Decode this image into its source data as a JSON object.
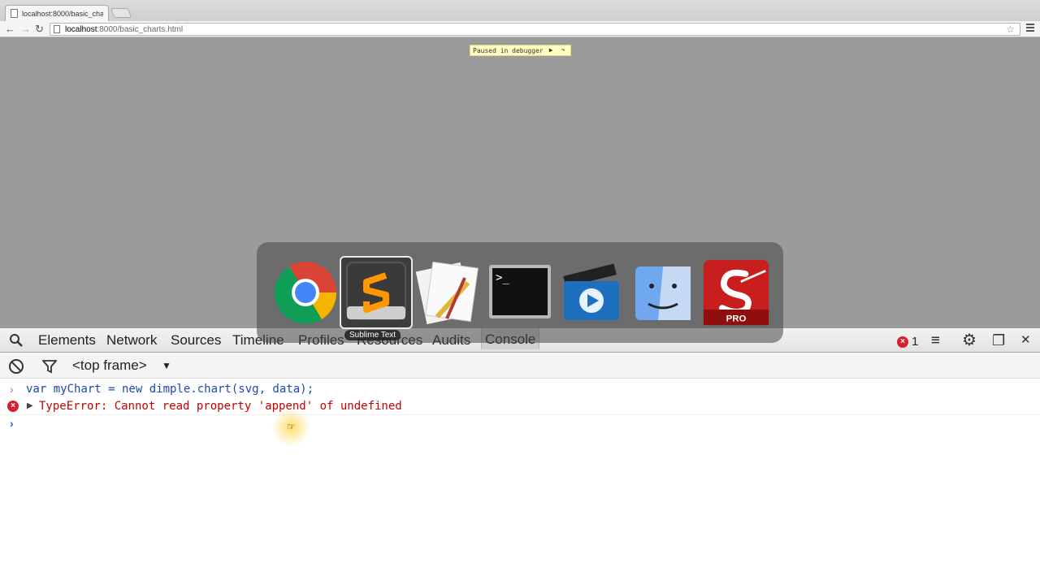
{
  "browser": {
    "tab_title": "localhost:8000/basic_char",
    "url_host": "localhost",
    "url_rest": ":8000/basic_charts.html"
  },
  "page": {
    "paused_text": "Paused in debugger"
  },
  "devtools": {
    "tabs": [
      "Elements",
      "Network",
      "Sources",
      "Timeline",
      "Profiles",
      "Resources",
      "Audits",
      "Console"
    ],
    "error_count": "1",
    "frame_selector": "<top frame>"
  },
  "console": {
    "command": "var myChart = new dimple.chart(svg, data);",
    "error": "TypeError: Cannot read property 'append' of undefined"
  },
  "switcher": {
    "selected_label": "Sublime Text",
    "apps": [
      "chrome-icon",
      "sublime-text-icon",
      "script-editor-icon",
      "terminal-icon",
      "video-editor-icon",
      "finder-icon",
      "sketchbook-pro-icon"
    ],
    "sketch_badge": "PRO"
  },
  "colors": {
    "error_red": "#c80000",
    "command_blue": "#1e47b4",
    "page_gray": "#9b9b9b"
  }
}
